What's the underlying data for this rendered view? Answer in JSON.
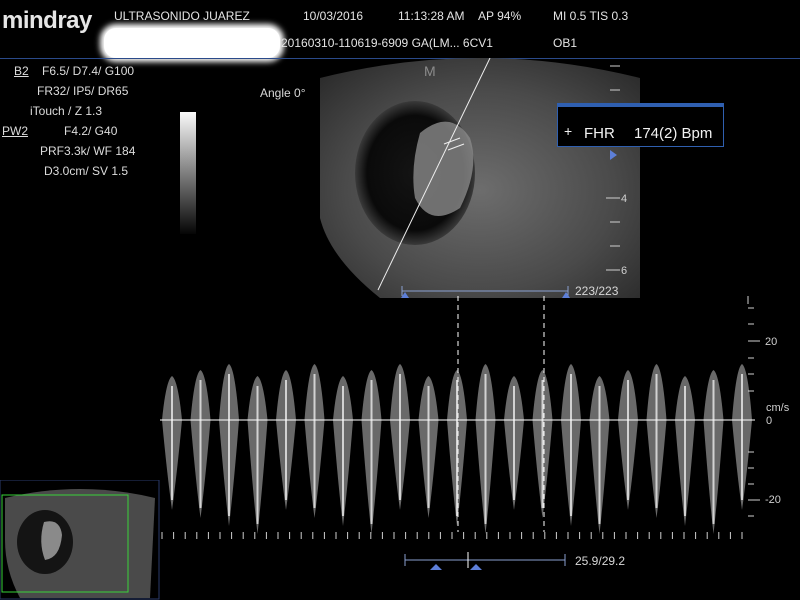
{
  "header": {
    "logo": "mindray",
    "institution": "ULTRASONIDO JUAREZ",
    "date": "10/03/2016",
    "time": "11:13:28 AM",
    "ap": "AP  94%",
    "mi_tis": "MI 0.5 TIS 0.3",
    "study_id": "20160310-110619-6909 GA(LM... 6CV1",
    "preset": "OB1"
  },
  "params": {
    "b_mode_label": "B2",
    "b_row1": "F6.5/    D7.4/   G100",
    "b_row2": "FR32/     IP5/   DR65",
    "b_row3": "iTouch     /      Z 1.3",
    "pw_label": "PW2",
    "pw_row1": "F4.2/         G40",
    "pw_row2": "PRF3.3k/   WF 184",
    "pw_row3": "D3.0cm/      SV 1.5"
  },
  "image": {
    "angle": "Angle 0°",
    "depth_marks": [
      "4",
      "6"
    ],
    "cine_counter": "223/223",
    "m_marker": "M"
  },
  "fhr_box": {
    "cross": "+",
    "label": "FHR",
    "value": "174(2) Bpm"
  },
  "doppler": {
    "unit": "cm/s",
    "scale_ticks": [
      "20",
      "0",
      "-20"
    ],
    "cine_counter": "25.9/29.2"
  }
}
